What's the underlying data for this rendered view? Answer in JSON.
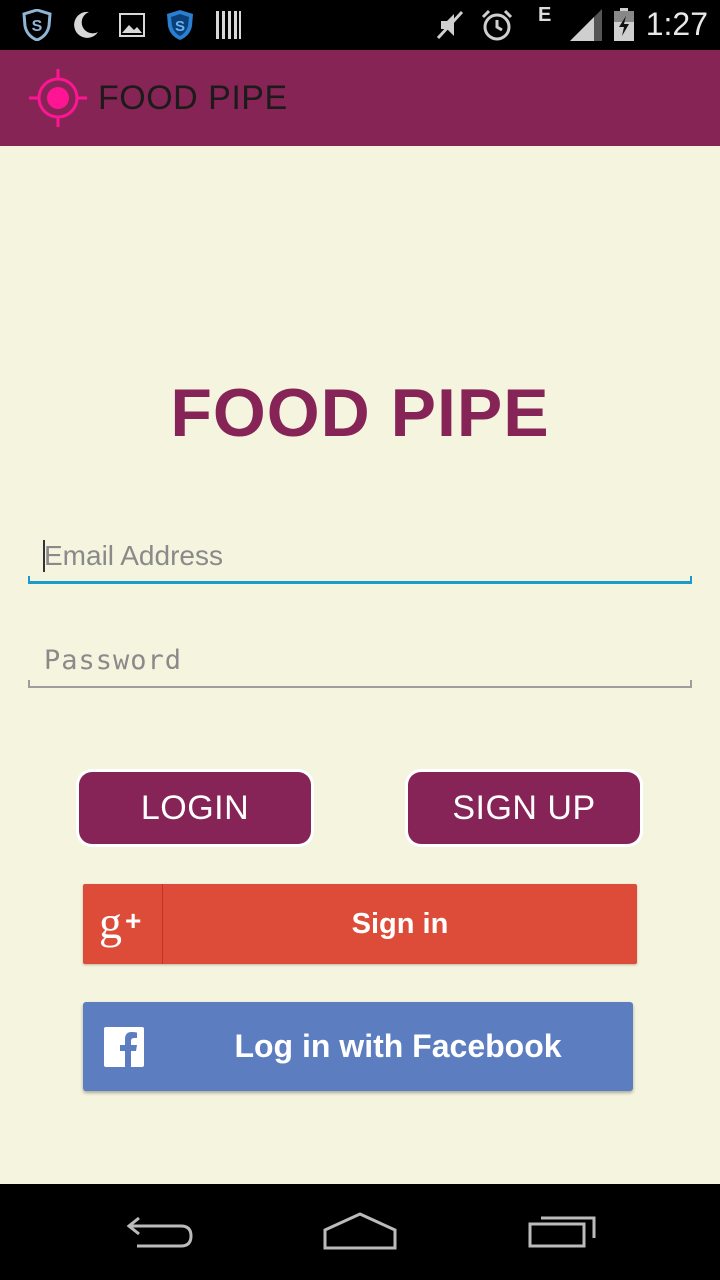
{
  "status_bar": {
    "time": "1:27",
    "network_type": "E",
    "icons_left": [
      "shield-icon",
      "moon-icon",
      "image-icon",
      "shield-icon",
      "barcode-icon"
    ],
    "icons_right": [
      "mute-icon",
      "alarm-icon",
      "signal-icon",
      "battery-icon"
    ]
  },
  "action_bar": {
    "title": "FOOD PIPE",
    "logo_color": "#ff1493"
  },
  "main": {
    "title": "FOOD PIPE",
    "email_placeholder": "Email Address",
    "password_placeholder": "Password",
    "login_label": "LOGIN",
    "signup_label": "SIGN UP",
    "google_label": "Sign in",
    "facebook_label": "Log in with Facebook"
  },
  "colors": {
    "brand": "#872456",
    "background": "#f4f4df",
    "google": "#dd4b39",
    "facebook": "#5c7dbf",
    "focus_underline": "#1c9ac9"
  },
  "nav_bar": {
    "buttons": [
      "back-icon",
      "home-icon",
      "recents-icon"
    ]
  }
}
